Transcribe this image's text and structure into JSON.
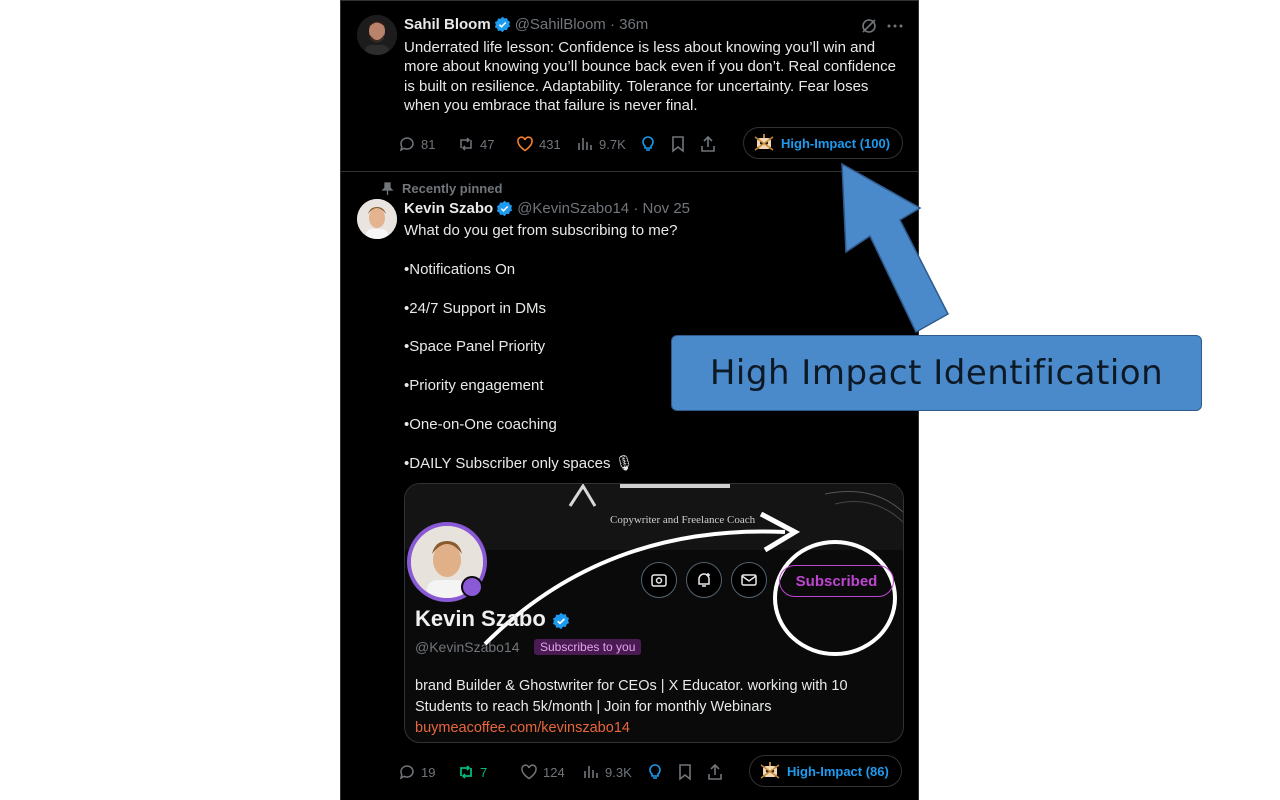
{
  "tweets": [
    {
      "author": "Sahil Bloom",
      "handle_time": "@SahilBloom · 36m",
      "text": "Underrated life lesson: Confidence is less about knowing you’ll win and\nmore about knowing you’ll bounce back even if you don’t. Real confidence\nis built on resilience. Adaptability. Tolerance for uncertainty. Fear loses\nwhen you embrace that failure is never final.",
      "replies": "81",
      "reposts": "47",
      "likes": "431",
      "views": "9.7K",
      "impact_badge": "High-Impact (100)",
      "colors": {
        "like": "#f4812b"
      }
    },
    {
      "pinned_label": "Recently pinned",
      "author": "Kevin Szabo",
      "handle_time": "@KevinSzabo14 · Nov 25",
      "text": "What do you get from subscribing to me?\n\n•Notifications On\n\n•24/7 Support in DMs\n\n•Space Panel Priority\n\n•Priority engagement\n\n•One-on-One coaching\n\n•DAILY Subscriber only spaces 🎙",
      "replies": "19",
      "reposts": "7",
      "likes": "124",
      "views": "9.3K",
      "impact_badge": "High-Impact (86)",
      "colors": {
        "repost": "#00ba7c"
      },
      "card": {
        "banner_text": "Copywriter and Freelance Coach",
        "subscribed_label": "Subscribed",
        "profile_name": "Kevin Szabo",
        "profile_handle": "@KevinSzabo14",
        "subscribes_badge": "Subscribes to you",
        "bio": "brand Builder & Ghostwriter for CEOs | X Educator. working with 10 Students to reach 5k/month | Join for monthly Webinars",
        "link": "buymeacoffee.com/kevinszabo14"
      }
    }
  ],
  "callout": {
    "label": "High Impact Identification",
    "color": "#4a8acb"
  },
  "icons": [
    "verified-icon",
    "grok-icon",
    "more-icon",
    "reply-icon",
    "repost-icon",
    "like-icon",
    "views-icon",
    "lightbulb-icon",
    "bookmark-icon",
    "share-icon",
    "robot-icon",
    "pin-icon",
    "media-icon",
    "notify-icon",
    "mail-icon"
  ],
  "colors": {
    "accent": "#1d9bf0",
    "background": "#000000",
    "subscribe": "#c044d4"
  }
}
